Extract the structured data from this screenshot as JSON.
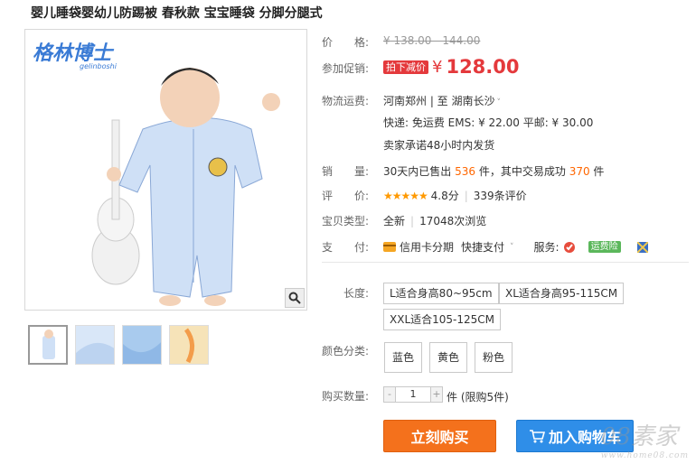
{
  "product": {
    "title": "婴儿睡袋婴幼儿防踢被 春秋款 宝宝睡袋 分脚分腿式"
  },
  "gallery": {
    "brand_logo": "格林博士",
    "brand_logo_sub": "gelinboshi",
    "zoom_icon": "magnifier-icon"
  },
  "price": {
    "label": "价　　格:",
    "original": "¥ 138.00 - 144.00",
    "promo_label": "参加促销:",
    "promo_tag": "拍下减价",
    "yen": "¥",
    "promo_price": "128.00"
  },
  "shipping": {
    "label": "物流运费:",
    "route": "河南郑州 | 至  湖南长沙",
    "fees": "快递: 免运费   EMS: ¥ 22.00   平邮: ¥ 30.00",
    "promise": "卖家承诺48小时内发货"
  },
  "sales": {
    "label": "销　　量:",
    "prefix": "30天内已售出",
    "sold": "536",
    "mid": "件，其中交易成功",
    "success": "370",
    "suffix": "件"
  },
  "rating": {
    "label": "评　　价:",
    "stars": "★★★★★",
    "score": "4.8分",
    "count": "339条评价"
  },
  "item_type": {
    "label": "宝贝类型:",
    "condition": "全新",
    "views": "17048次浏览"
  },
  "payment": {
    "label": "支　　付:",
    "credit": "信用卡分期",
    "quick": "快捷支付",
    "service_label": "服务:",
    "badge": "运费险"
  },
  "options": {
    "length_label": "长度:",
    "lengths": [
      "L适合身高80~95cm",
      "XL适合身高95-115CM",
      "XXL适合105-125CM"
    ],
    "color_label": "颜色分类:",
    "colors": [
      "蓝色",
      "黄色",
      "粉色"
    ],
    "qty_label": "购买数量:",
    "qty_value": "1",
    "qty_minus": "-",
    "qty_plus": "+",
    "qty_suffix": "件 (限购5件)"
  },
  "actions": {
    "buy_now": "立刻购买",
    "add_cart": "加入购物车"
  },
  "watermark": {
    "text": "08素家",
    "sub": "www.home08.com"
  },
  "colors": {
    "price_red": "#e4393c",
    "orange": "#ff6600",
    "buy_orange": "#f4711c",
    "cart_blue": "#2f8ee8"
  }
}
